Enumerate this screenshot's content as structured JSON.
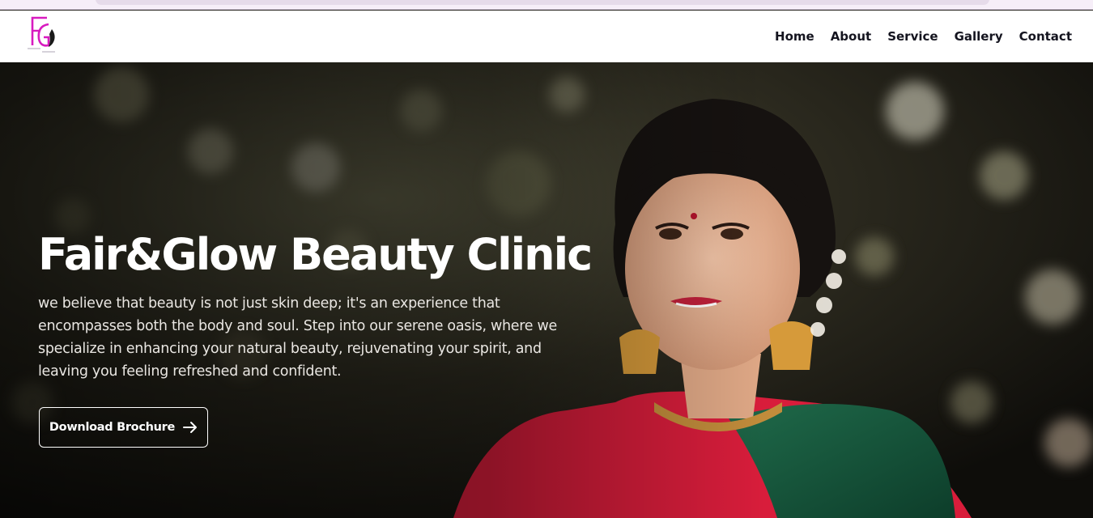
{
  "nav": {
    "items": [
      {
        "label": "Home"
      },
      {
        "label": "About"
      },
      {
        "label": "Service"
      },
      {
        "label": "Gallery"
      },
      {
        "label": "Contact"
      }
    ]
  },
  "logo": {
    "icon": "fair-and-glow-logo",
    "accent": "#d81bbf"
  },
  "hero": {
    "title": "Fair&Glow Beauty Clinic",
    "description": "we believe that beauty is not just skin deep; it's an experience that encompasses both the body and soul. Step into our serene oasis, where we specialize in enhancing your natural beauty, rejuvenating your spirit, and leaving you feeling refreshed and confident.",
    "button_label": "Download Brochure",
    "button_icon": "arrow-right-icon"
  }
}
